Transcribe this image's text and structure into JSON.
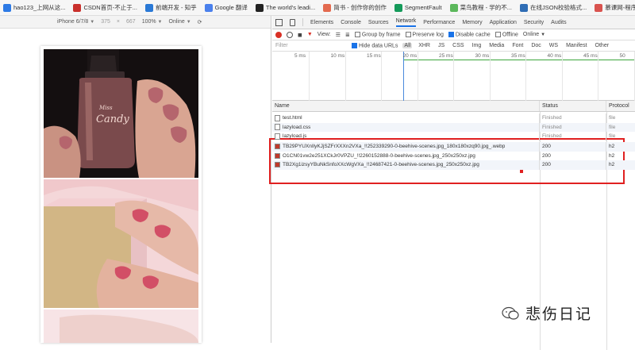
{
  "bookmarks": [
    {
      "label": "hao123_上网从这...",
      "color": "#2d7ae5"
    },
    {
      "label": "CSDN首页-不止于...",
      "color": "#c9302c"
    },
    {
      "label": "前端开发 - 知乎",
      "color": "#2a79d6"
    },
    {
      "label": "Google 翻译",
      "color": "#4a80ec"
    },
    {
      "label": "The world's leadi...",
      "color": "#222222"
    },
    {
      "label": "简书 - 创作你的创作",
      "color": "#e36a4f"
    },
    {
      "label": "SegmentFault",
      "color": "#159a5a"
    },
    {
      "label": "菜鸟教程 - 学的不...",
      "color": "#5cb85c"
    },
    {
      "label": "在线JSON校验格式...",
      "color": "#2f6db5"
    },
    {
      "label": "慕课网-程序员的梦...",
      "color": "#d9534f"
    }
  ],
  "device_toolbar": {
    "device": "iPhone 6/7/8",
    "width": "375",
    "times": "×",
    "height": "667",
    "zoom": "100%",
    "network": "Online"
  },
  "devtools": {
    "tabs": [
      "Elements",
      "Console",
      "Sources",
      "Network",
      "Performance",
      "Memory",
      "Application",
      "Security",
      "Audits"
    ],
    "active_tab": "Network",
    "toolbar": {
      "view_label": "View:",
      "group_by_frame": "Group by frame",
      "preserve_log": "Preserve log",
      "disable_cache": "Disable cache",
      "offline": "Offline",
      "online": "Online"
    },
    "filter": {
      "placeholder": "Filter",
      "hide_data_urls": "Hide data URLs",
      "types": [
        "All",
        "XHR",
        "JS",
        "CSS",
        "Img",
        "Media",
        "Font",
        "Doc",
        "WS",
        "Manifest",
        "Other"
      ]
    },
    "timeline_ticks": [
      "5 ms",
      "10 ms",
      "15 ms",
      "20 ms",
      "25 ms",
      "30 ms",
      "35 ms",
      "40 ms",
      "45 ms",
      "50"
    ],
    "columns": {
      "name": "Name",
      "status": "Status",
      "protocol": "Protocol"
    },
    "requests": [
      {
        "name": "test.html",
        "status": "Finished",
        "protocol": "file",
        "kind": "doc"
      },
      {
        "name": "lazyload.css",
        "status": "Finished",
        "protocol": "file",
        "kind": "doc"
      },
      {
        "name": "lazyload.js",
        "status": "Finished",
        "protocol": "file",
        "kind": "doc"
      },
      {
        "name": "TB29PYUXnIlyKJjSZFrXXXn2VXa_!!252339290-0-beehive-scenes.jpg_180x180xzq90.jpg_.webp",
        "status": "200",
        "protocol": "h2",
        "kind": "img"
      },
      {
        "name": "O1CN01vw2e251XCkJr0VPZU_!!2260152888-0-beehive-scenes.jpg_250x250xz.jpg",
        "status": "200",
        "protocol": "h2",
        "kind": "img"
      },
      {
        "name": "TB2Xg1izsyYBuNkSnfoXXcWgVXa_!!24687421-0-beehive-scenes.jpg_250x250xz.jpg",
        "status": "200",
        "protocol": "h2",
        "kind": "img"
      }
    ]
  },
  "watermark": {
    "text": "悲伤日记"
  },
  "colors": {
    "highlight": "#e02020",
    "accent": "#1a73e8",
    "record": "#d93025"
  }
}
